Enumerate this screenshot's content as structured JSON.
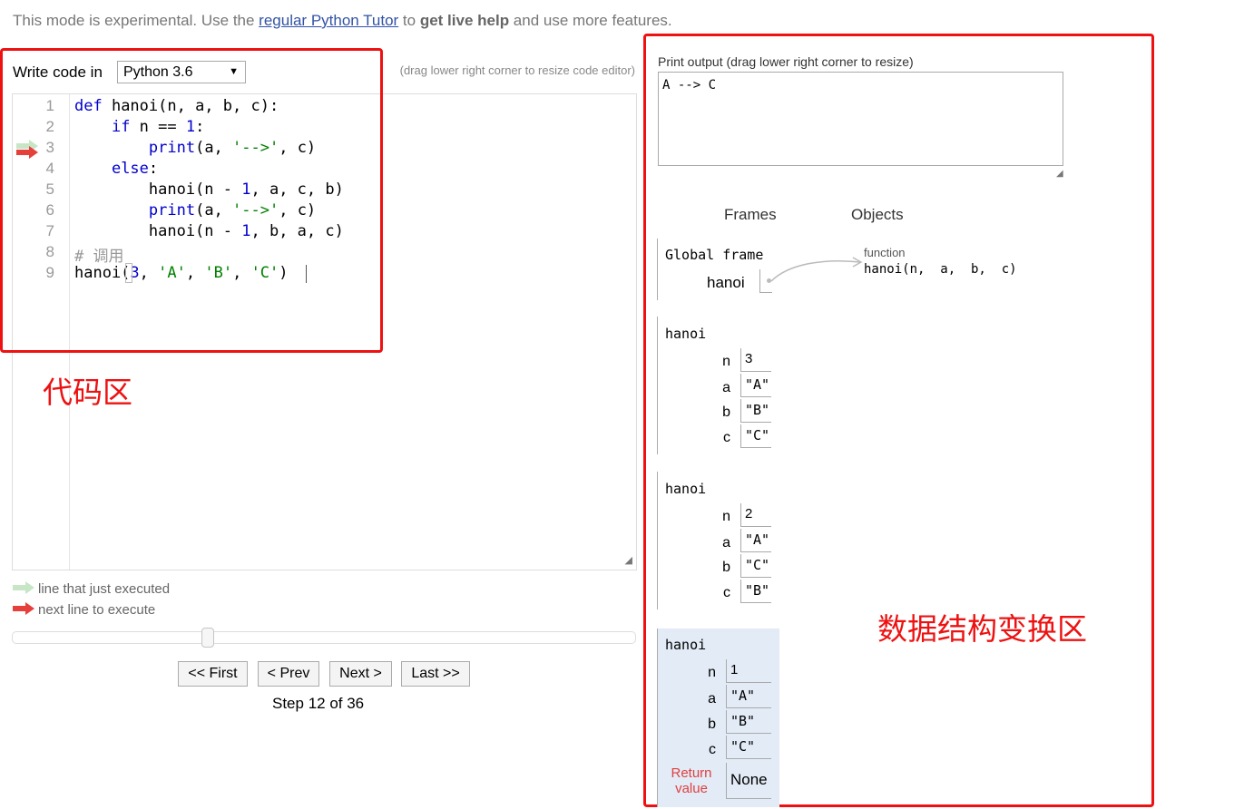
{
  "banner": {
    "prefix": "This mode is experimental. Use the ",
    "link": "regular Python Tutor",
    "middle": " to ",
    "bold": "get live help",
    "suffix": " and use more features."
  },
  "editor": {
    "write_label": "Write code in",
    "language": "Python 3.6",
    "resize_hint": "(drag lower right corner to resize code editor)",
    "line_numbers": [
      "1",
      "2",
      "3",
      "4",
      "5",
      "6",
      "7",
      "8",
      "9"
    ]
  },
  "legend": {
    "executed": "line that just executed",
    "next": "next line to execute"
  },
  "navigation": {
    "first": "<< First",
    "prev": "< Prev",
    "next": "Next >",
    "last": "Last >>",
    "step_label": "Step 12 of 36",
    "slider_progress": 0.31
  },
  "annotations": {
    "code_area": "代码区",
    "data_area": "数据结构变换区"
  },
  "output": {
    "label": "Print output (drag lower right corner to resize)",
    "text": "A --> C"
  },
  "viz": {
    "frames_header": "Frames",
    "objects_header": "Objects",
    "global_frame": {
      "title": "Global frame",
      "var": "hanoi"
    },
    "function_object": {
      "type": "function",
      "signature": "hanoi(n,  a,  b,  c)"
    },
    "frames": [
      {
        "title": "hanoi",
        "vars": [
          {
            "name": "n",
            "value": "3"
          },
          {
            "name": "a",
            "value": "\"A\""
          },
          {
            "name": "b",
            "value": "\"B\""
          },
          {
            "name": "c",
            "value": "\"C\""
          }
        ]
      },
      {
        "title": "hanoi",
        "vars": [
          {
            "name": "n",
            "value": "2"
          },
          {
            "name": "a",
            "value": "\"A\""
          },
          {
            "name": "b",
            "value": "\"C\""
          },
          {
            "name": "c",
            "value": "\"B\""
          }
        ]
      },
      {
        "title": "hanoi",
        "vars": [
          {
            "name": "n",
            "value": "1"
          },
          {
            "name": "a",
            "value": "\"A\""
          },
          {
            "name": "b",
            "value": "\"B\""
          },
          {
            "name": "c",
            "value": "\"C\""
          }
        ],
        "return_label": "Return value",
        "return_value": "None"
      }
    ]
  },
  "colors": {
    "executed_arrow": "#c6e6c6",
    "next_arrow": "#e5403a",
    "annotation": "#ee1111",
    "selected_frame": "#e2ebf6"
  }
}
